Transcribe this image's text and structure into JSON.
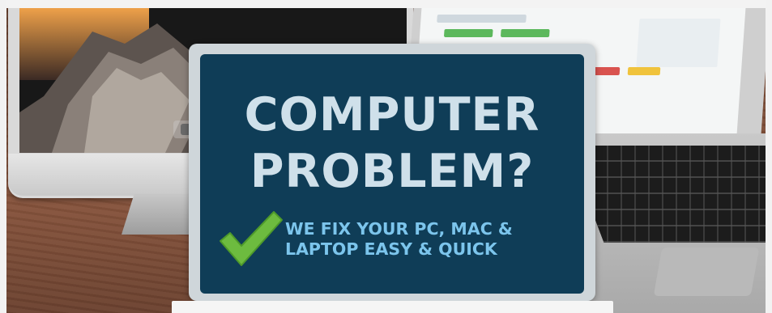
{
  "banner": {
    "headline_line1": "COMPUTER",
    "headline_line2": "PROBLEM?",
    "tagline_line1": "WE FIX YOUR PC, MAC &",
    "tagline_line2": "LAPTOP EASY & QUICK",
    "icon": "checkmark-icon"
  },
  "colors": {
    "sign_background": "#0f3d57",
    "sign_border": "#cfd6da",
    "headline_text": "#cfe0ea",
    "tagline_text": "#7cc5ec",
    "checkmark": "#6dbb3f",
    "desk_wood": "#7a4c37"
  }
}
